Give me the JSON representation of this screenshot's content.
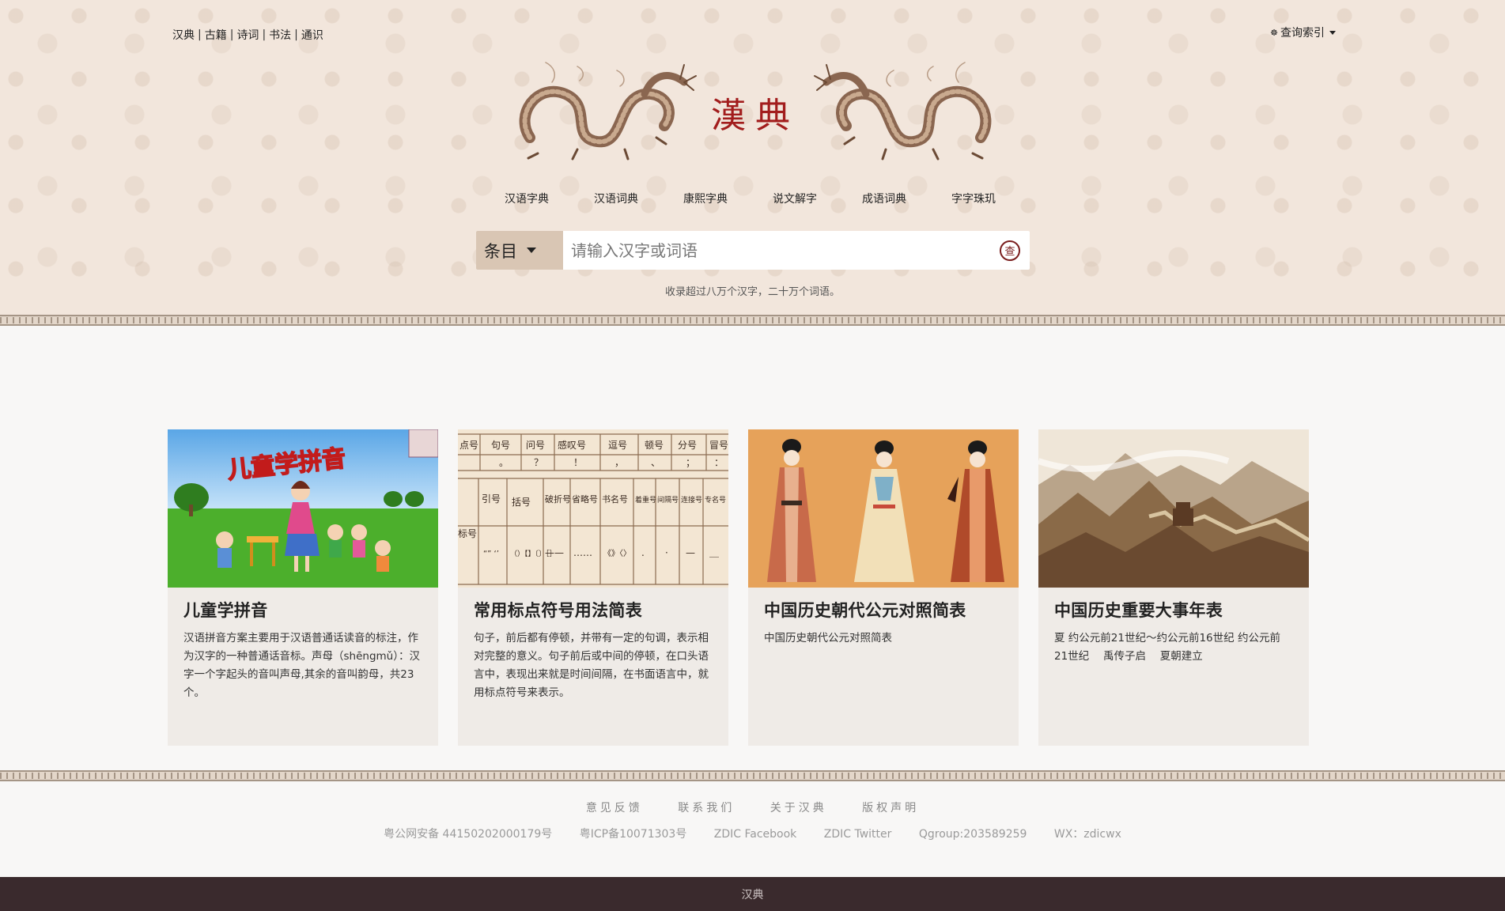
{
  "topnav": {
    "items": [
      "汉典",
      "古籍",
      "诗词",
      "书法",
      "通识"
    ],
    "separator": "|"
  },
  "index_menu": {
    "label": "查询索引",
    "glyph": "☸"
  },
  "logo": {
    "text": "漢典"
  },
  "dict_nav": [
    "汉语字典",
    "汉语词典",
    "康熙字典",
    "说文解字",
    "成语词典",
    "字字珠玑"
  ],
  "search": {
    "category": "条目",
    "placeholder": "请输入汉字或词语",
    "button_glyph": "查"
  },
  "tagline": "收录超过八万个汉字，二十万个词语。",
  "cards": [
    {
      "title": "儿童学拼音",
      "desc": "汉语拼音方案主要用于汉语普通话读音的标注，作为汉字的一种普通话音标。声母（shēngmǔ）：汉字一个字起头的音叫声母,其余的音叫韵母，共23个。",
      "image": {
        "banner": "儿童学拼音"
      }
    },
    {
      "title": "常用标点符号用法简表",
      "desc": "句子，前后都有停顿，并带有一定的句调，表示相对完整的意义。句子前后或中间的停顿，在口头语言中，表现出来就是时间间隔，在书面语言中，就用标点符号来表示。",
      "image": {
        "row1": [
          "点号",
          "句号",
          "问号",
          "感叹号",
          "逗号",
          "顿号",
          "分号",
          "冒号"
        ],
        "row1_marks": [
          "",
          "。",
          "？",
          "！",
          "，",
          "、",
          "；",
          "："
        ],
        "row2": [
          "",
          "引号",
          "括号",
          "破折号",
          "省略号",
          "书名号",
          "着重号",
          "间隔号",
          "连接号",
          "专名号"
        ],
        "row2_marks": [
          "标号",
          "“” ‘’",
          "（）【】〔〕［］",
          "——",
          "……",
          "《》〈〉",
          ".",
          "·",
          "—",
          "＿"
        ]
      }
    },
    {
      "title": "中国历史朝代公元对照简表",
      "desc": "中国历史朝代公元对照简表",
      "image": {}
    },
    {
      "title": "中国历史重要大事年表",
      "desc": "夏 约公元前21世纪～约公元前16世纪 约公元前21世纪　 禹传子启　 夏朝建立",
      "image": {}
    }
  ],
  "footer": {
    "links": [
      "意见反馈",
      "联系我们",
      "关于汉典",
      "版权声明"
    ],
    "info": [
      "粤公网安备 44150202000179号",
      "粤ICP备10071303号",
      "ZDIC Facebook",
      "ZDIC Twitter",
      "Qgroup:203589259",
      "WX：zdicwx"
    ],
    "bottom": "汉典"
  },
  "colors": {
    "header_bg": "#f2e6dc",
    "accent_red": "#a21d1d",
    "card_bg": "#efebe7",
    "bottom_bar": "#3a2a2d",
    "search_cat_bg": "#d9c6b4"
  }
}
